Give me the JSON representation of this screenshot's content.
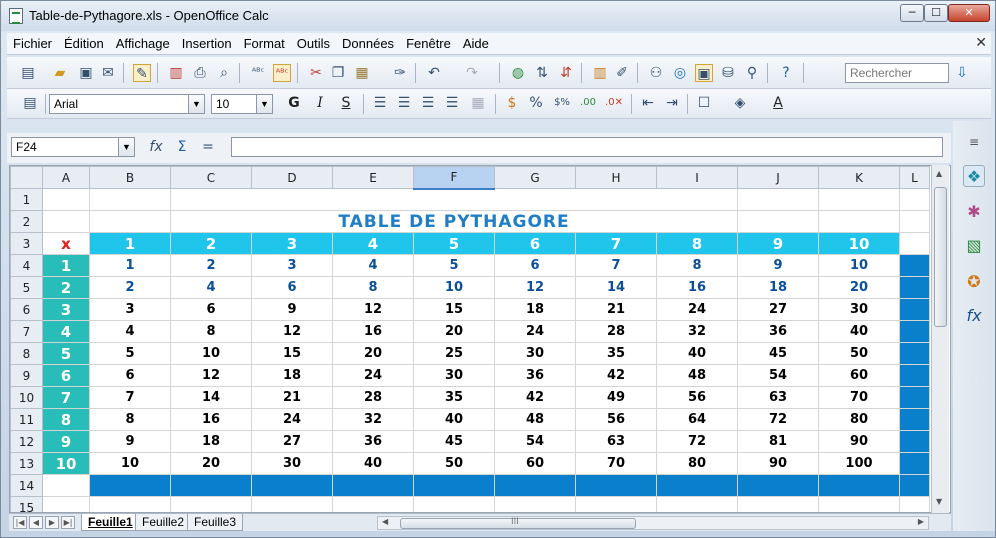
{
  "window": {
    "title": "Table-de-Pythagore.xls - OpenOffice Calc",
    "min": "─",
    "max": "☐",
    "close": "✕"
  },
  "menu": [
    "Fichier",
    "Édition",
    "Affichage",
    "Insertion",
    "Format",
    "Outils",
    "Données",
    "Fenêtre",
    "Aide"
  ],
  "menu_close": "✕",
  "toolbar1": {
    "search_placeholder": "Rechercher"
  },
  "toolbar2": {
    "font_name": "Arial",
    "font_size": "10",
    "bold": "G",
    "italic": "I",
    "shadow": "S"
  },
  "formula": {
    "cell_ref": "F24",
    "value": ""
  },
  "columns": [
    "A",
    "B",
    "C",
    "D",
    "E",
    "F",
    "G",
    "H",
    "I",
    "J",
    "K",
    "L"
  ],
  "selected_column": "F",
  "rows": [
    "1",
    "2",
    "3",
    "4",
    "5",
    "6",
    "7",
    "8",
    "9",
    "10",
    "11",
    "12",
    "13",
    "14",
    "15"
  ],
  "sheet": {
    "title": "TABLE DE PYTHAGORE",
    "corner_label": "x",
    "header": [
      "1",
      "2",
      "3",
      "4",
      "5",
      "6",
      "7",
      "8",
      "9",
      "10"
    ],
    "row_labels": [
      "1",
      "2",
      "3",
      "4",
      "5",
      "6",
      "7",
      "8",
      "9",
      "10"
    ],
    "table": [
      [
        "1",
        "2",
        "3",
        "4",
        "5",
        "6",
        "7",
        "8",
        "9",
        "10"
      ],
      [
        "2",
        "4",
        "6",
        "8",
        "10",
        "12",
        "14",
        "16",
        "18",
        "20"
      ],
      [
        "3",
        "6",
        "9",
        "12",
        "15",
        "18",
        "21",
        "24",
        "27",
        "30"
      ],
      [
        "4",
        "8",
        "12",
        "16",
        "20",
        "24",
        "28",
        "32",
        "36",
        "40"
      ],
      [
        "5",
        "10",
        "15",
        "20",
        "25",
        "30",
        "35",
        "40",
        "45",
        "50"
      ],
      [
        "6",
        "12",
        "18",
        "24",
        "30",
        "36",
        "42",
        "48",
        "54",
        "60"
      ],
      [
        "7",
        "14",
        "21",
        "28",
        "35",
        "42",
        "49",
        "56",
        "63",
        "70"
      ],
      [
        "8",
        "16",
        "24",
        "32",
        "40",
        "48",
        "56",
        "64",
        "72",
        "80"
      ],
      [
        "9",
        "18",
        "27",
        "36",
        "45",
        "54",
        "63",
        "72",
        "81",
        "90"
      ],
      [
        "10",
        "20",
        "30",
        "40",
        "50",
        "60",
        "70",
        "80",
        "90",
        "100"
      ]
    ]
  },
  "tabs": [
    "Feuille1",
    "Feuille2",
    "Feuille3"
  ],
  "active_tab": "Feuille1",
  "hscroll_label": "III",
  "colors": {
    "header": "#20c5ec",
    "row_label": "#28bdb8",
    "strip": "#0a7fcc",
    "title": "#1f7fc6",
    "x": "#e0201a",
    "blue_text": "#0b4e9a"
  }
}
